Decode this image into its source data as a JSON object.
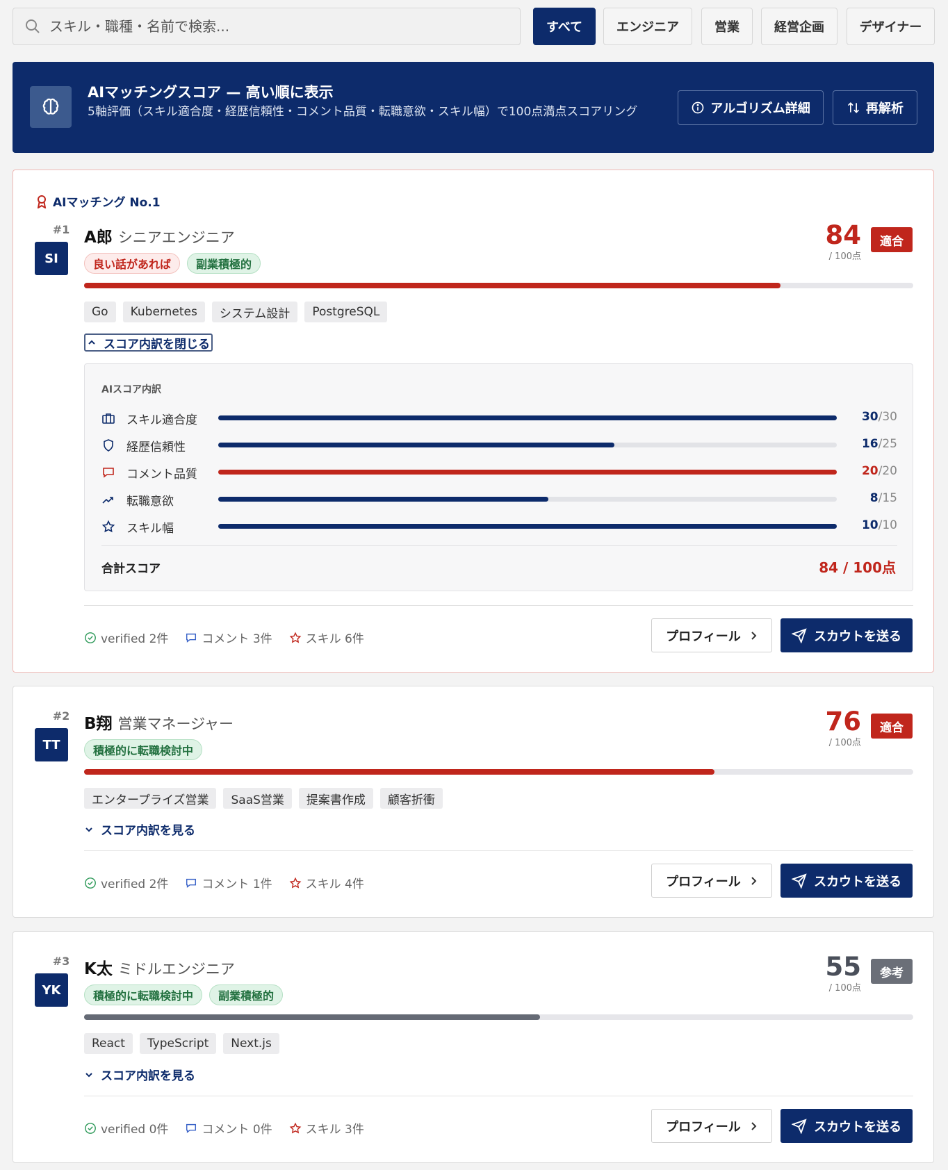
{
  "search": {
    "placeholder": "スキル・職種・名前で検索..."
  },
  "filters": [
    "すべて",
    "エンジニア",
    "営業",
    "経営企画",
    "デザイナー"
  ],
  "banner": {
    "title": "AIマッチングスコア — 高い順に表示",
    "subtitle": "5軸評価（スキル適合度・経歴信頼性・コメント品質・転職意欲・スキル幅）で100点満点スコアリング",
    "algo_label": "アルゴリズム詳細",
    "reanalyze_label": "再解析"
  },
  "colors": {
    "navy": "#0d2b6b",
    "red": "#c0261c",
    "gray": "#6b6f78",
    "green": "#22703f"
  },
  "candidates": [
    {
      "badge": "AIマッチング No.1",
      "rank": "#1",
      "initials": "SI",
      "name": "A郎",
      "role": "シニアエンジニア",
      "tags": [
        "良い話があれば",
        "副業積極的"
      ],
      "score": "84",
      "score_sub": "/ 100点",
      "verdict": "適合",
      "progress": 0.84,
      "skills": [
        "Go",
        "Kubernetes",
        "システム設計",
        "PostgreSQL"
      ],
      "toggle": "スコア内訳を閉じる",
      "breakdown": {
        "title": "AIスコア内訳",
        "rows": [
          {
            "label": "スキル適合度",
            "value": "30",
            "max": "/30",
            "icon": "briefcase-icon"
          },
          {
            "label": "経歴信頼性",
            "value": "16",
            "max": "/25",
            "icon": "shield-icon"
          },
          {
            "label": "コメント品質",
            "value": "20",
            "max": "/20",
            "icon": "comment-icon"
          },
          {
            "label": "転職意欲",
            "value": "8",
            "max": "/15",
            "icon": "trending-icon"
          },
          {
            "label": "スキル幅",
            "value": "10",
            "max": "/10",
            "icon": "star-icon"
          }
        ],
        "total_label": "合計スコア",
        "total_value": "84 / 100点"
      },
      "stats": [
        "verified 2件",
        "コメント 3件",
        "スキル 6件"
      ],
      "profile_label": "プロフィール",
      "scout_label": "スカウトを送る"
    },
    {
      "rank": "#2",
      "initials": "TT",
      "name": "B翔",
      "role": "営業マネージャー",
      "tags": [
        "積極的に転職検討中"
      ],
      "score": "76",
      "score_sub": "/ 100点",
      "verdict": "適合",
      "progress": 0.76,
      "skills": [
        "エンタープライズ営業",
        "SaaS営業",
        "提案書作成",
        "顧客折衝"
      ],
      "toggle": "スコア内訳を見る",
      "stats": [
        "verified 2件",
        "コメント 1件",
        "スキル 4件"
      ],
      "profile_label": "プロフィール",
      "scout_label": "スカウトを送る"
    },
    {
      "rank": "#3",
      "initials": "YK",
      "name": "K太",
      "role": "ミドルエンジニア",
      "tags": [
        "積極的に転職検討中",
        "副業積極的"
      ],
      "score": "55",
      "score_sub": "/ 100点",
      "verdict": "参考",
      "progress": 0.55,
      "skills": [
        "React",
        "TypeScript",
        "Next.js"
      ],
      "toggle": "スコア内訳を見る",
      "stats": [
        "verified 0件",
        "コメント 0件",
        "スキル 3件"
      ],
      "profile_label": "プロフィール",
      "scout_label": "スカウトを送る"
    }
  ]
}
